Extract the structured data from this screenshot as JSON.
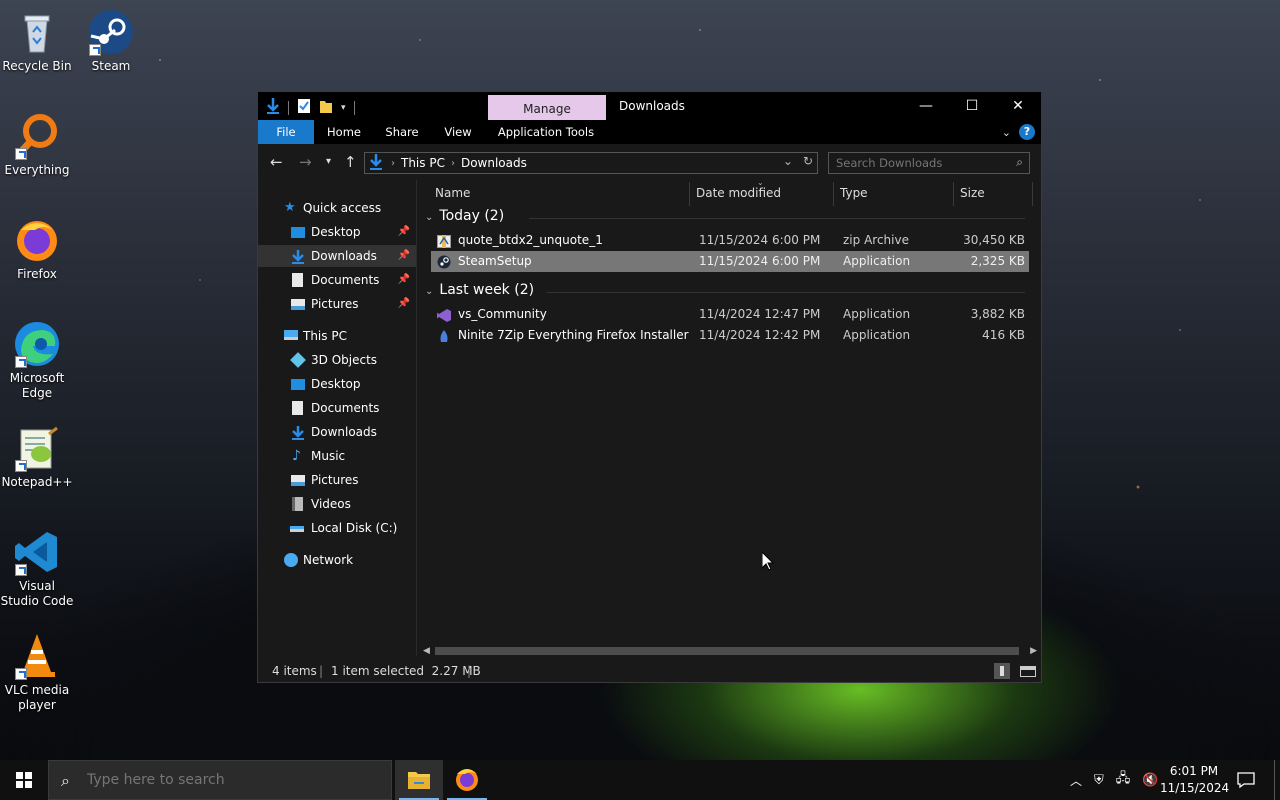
{
  "desktop": {
    "icons": [
      {
        "label": "Recycle Bin"
      },
      {
        "label": "Steam"
      },
      {
        "label": "Everything"
      },
      {
        "label": "Firefox"
      },
      {
        "label": "Microsoft Edge"
      },
      {
        "label": "Notepad++"
      },
      {
        "label": "Visual Studio Code"
      },
      {
        "label": "VLC media player"
      }
    ]
  },
  "window": {
    "title": "Downloads",
    "contextual_tab": "Manage",
    "ribbon_tabs": [
      "File",
      "Home",
      "Share",
      "View",
      "Application Tools"
    ],
    "controls": {
      "minimize": "—",
      "maximize": "☐",
      "close": "✕"
    },
    "help_label": "?"
  },
  "address": {
    "crumbs": [
      "This PC",
      "Downloads"
    ],
    "search_placeholder": "Search Downloads"
  },
  "navpane": {
    "quick_access": "Quick access",
    "quick_items": [
      {
        "label": "Desktop",
        "pinned": true
      },
      {
        "label": "Downloads",
        "pinned": true,
        "selected": true
      },
      {
        "label": "Documents",
        "pinned": true
      },
      {
        "label": "Pictures",
        "pinned": true
      }
    ],
    "this_pc": "This PC",
    "pc_items": [
      "3D Objects",
      "Desktop",
      "Documents",
      "Downloads",
      "Music",
      "Pictures",
      "Videos",
      "Local Disk (C:)"
    ],
    "network": "Network"
  },
  "filelist": {
    "columns": [
      "Name",
      "Date modified",
      "Type",
      "Size"
    ],
    "groups": [
      {
        "label": "Today (2)",
        "files": [
          {
            "name": "quote_btdx2_unquote_1",
            "date": "11/15/2024 6:00 PM",
            "type": "zip Archive",
            "size": "30,450 KB",
            "selected": false
          },
          {
            "name": "SteamSetup",
            "date": "11/15/2024 6:00 PM",
            "type": "Application",
            "size": "2,325 KB",
            "selected": true
          }
        ]
      },
      {
        "label": "Last week (2)",
        "files": [
          {
            "name": "vs_Community",
            "date": "11/4/2024 12:47 PM",
            "type": "Application",
            "size": "3,882 KB",
            "selected": false
          },
          {
            "name": "Ninite 7Zip Everything Firefox Installer",
            "date": "11/4/2024 12:42 PM",
            "type": "Application",
            "size": "416 KB",
            "selected": false
          }
        ]
      }
    ]
  },
  "statusbar": {
    "items": "4 items",
    "selection": "1 item selected  2.27 MB"
  },
  "taskbar": {
    "search_placeholder": "Type here to search",
    "time": "6:01 PM",
    "date": "11/15/2024"
  },
  "colors": {
    "accent": "#1979ca",
    "manage_tab": "#e5c8ea",
    "selection": "#777777",
    "window_bg": "#191919"
  }
}
